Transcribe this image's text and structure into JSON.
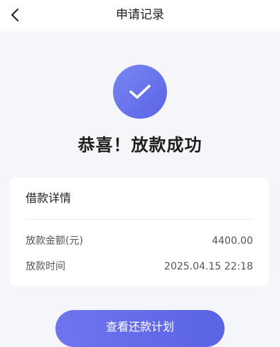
{
  "header": {
    "title": "申请记录"
  },
  "status": {
    "title": "恭喜！放款成功"
  },
  "details": {
    "title": "借款详情",
    "rows": [
      {
        "label": "放款金额(元)",
        "value": "4400.00"
      },
      {
        "label": "放款时间",
        "value": "2025.04.15 22:18"
      }
    ]
  },
  "actions": {
    "repayment_plan_label": "查看还款计划"
  },
  "colors": {
    "accent": "#5b63e6",
    "background": "#f5f6fa"
  },
  "icons": {
    "back": "chevron-left-icon",
    "success": "check-icon"
  }
}
